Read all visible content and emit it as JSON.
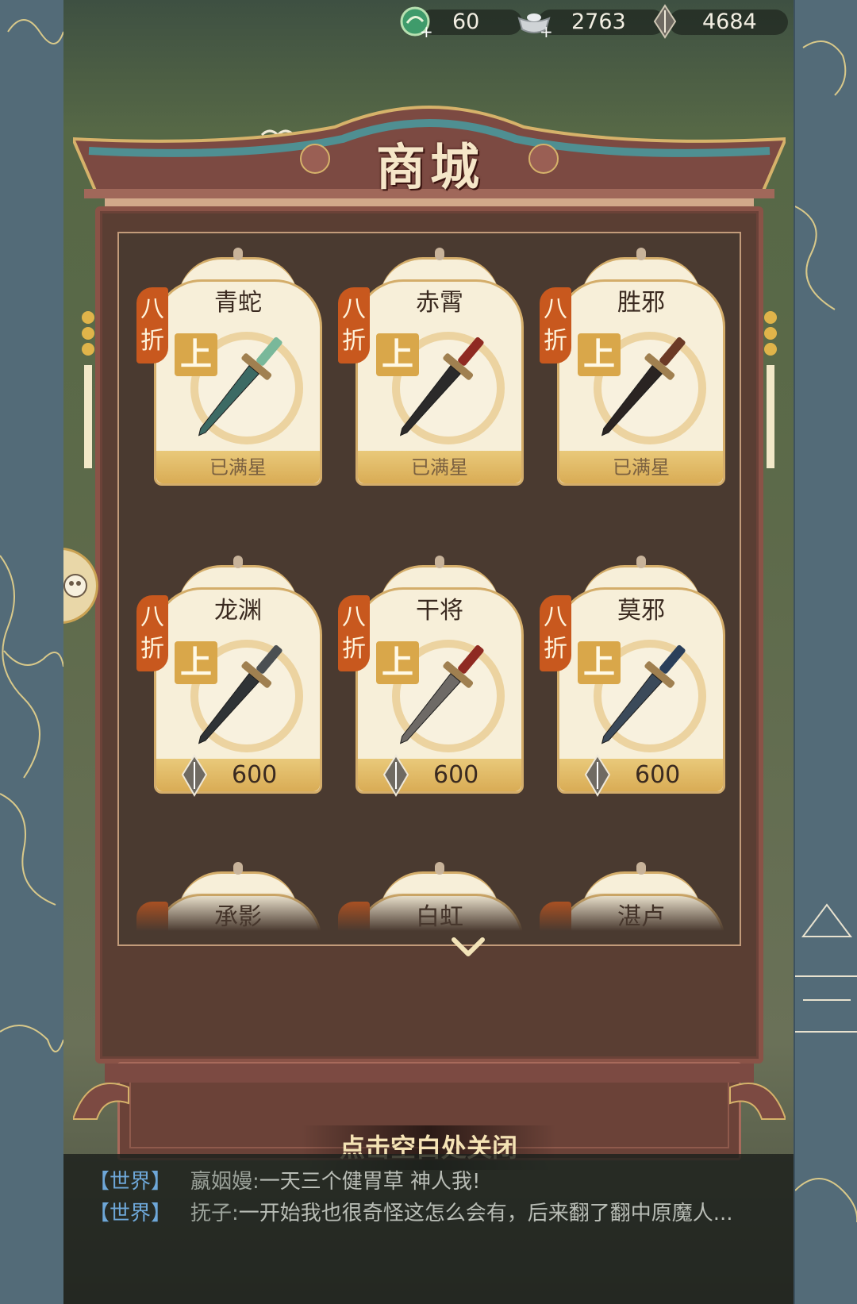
{
  "topbar": {
    "jade": {
      "icon": "jade-dragon-icon",
      "value": "60"
    },
    "silver": {
      "icon": "silver-ingot-icon",
      "value": "2763"
    },
    "crystal": {
      "icon": "crystal-icon",
      "value": "4684"
    }
  },
  "shop": {
    "title": "商城",
    "items": [
      {
        "name": "青蛇",
        "discount": [
          "八",
          "折"
        ],
        "grade": "上",
        "status": "已满星",
        "price": null,
        "blade": "#3c6a64",
        "hilt": "#79b89a"
      },
      {
        "name": "赤霄",
        "discount": [
          "八",
          "折"
        ],
        "grade": "上",
        "status": "已满星",
        "price": null,
        "blade": "#2b2a2a",
        "hilt": "#8f2a22"
      },
      {
        "name": "胜邪",
        "discount": [
          "八",
          "折"
        ],
        "grade": "上",
        "status": "已满星",
        "price": null,
        "blade": "#2a2422",
        "hilt": "#6b3a26"
      },
      {
        "name": "龙渊",
        "discount": [
          "八",
          "折"
        ],
        "grade": "上",
        "status": null,
        "price": "600",
        "blade": "#2f3336",
        "hilt": "#4b4f52"
      },
      {
        "name": "干将",
        "discount": [
          "八",
          "折"
        ],
        "grade": "上",
        "status": null,
        "price": "600",
        "blade": "#6e6a66",
        "hilt": "#8f2a22"
      },
      {
        "name": "莫邪",
        "discount": [
          "八",
          "折"
        ],
        "grade": "上",
        "status": null,
        "price": "600",
        "blade": "#3b4a5a",
        "hilt": "#2a3f5a"
      }
    ],
    "partial_items": [
      {
        "name": "承影"
      },
      {
        "name": "白虹"
      },
      {
        "name": "湛卢"
      }
    ]
  },
  "close_hint": "点击空白处关闭",
  "chat": [
    {
      "channel": "【世界】",
      "sender": "嬴姻嫚:",
      "text": "一天三个健胃草 神人我!"
    },
    {
      "channel": "【世界】",
      "sender": "抚子:",
      "text": "一开始我也很奇怪这怎么会有，后来翻了翻中原魔人..."
    }
  ]
}
